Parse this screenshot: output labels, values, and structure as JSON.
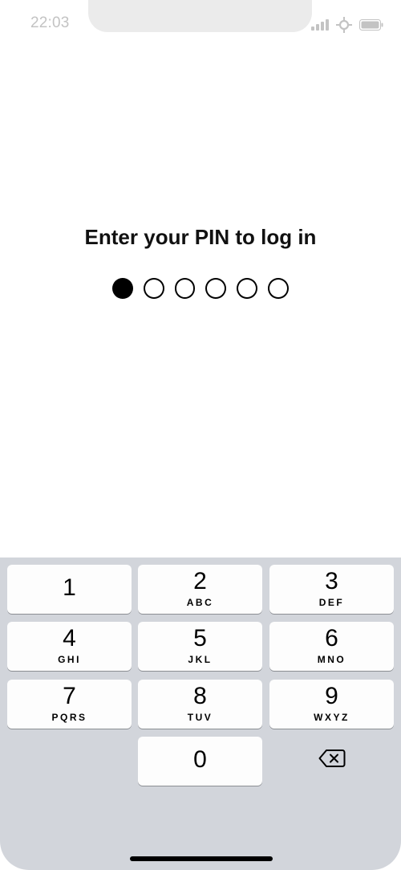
{
  "status_bar": {
    "time": "22:03",
    "icons": [
      "signal-icon",
      "wifi-icon",
      "battery-icon"
    ],
    "text_color": "#c3c3c3"
  },
  "prompt": {
    "title": "Enter your PIN to log in"
  },
  "pin": {
    "length": 6,
    "entered": 1
  },
  "keypad": {
    "background": "#d2d5db",
    "keys": [
      {
        "digit": "1",
        "letters": ""
      },
      {
        "digit": "2",
        "letters": "ABC"
      },
      {
        "digit": "3",
        "letters": "DEF"
      },
      {
        "digit": "4",
        "letters": "GHI"
      },
      {
        "digit": "5",
        "letters": "JKL"
      },
      {
        "digit": "6",
        "letters": "MNO"
      },
      {
        "digit": "7",
        "letters": "PQRS"
      },
      {
        "digit": "8",
        "letters": "TUV"
      },
      {
        "digit": "9",
        "letters": "WXYZ"
      },
      {
        "digit": "0",
        "letters": ""
      }
    ],
    "backspace_icon": "backspace-icon"
  }
}
